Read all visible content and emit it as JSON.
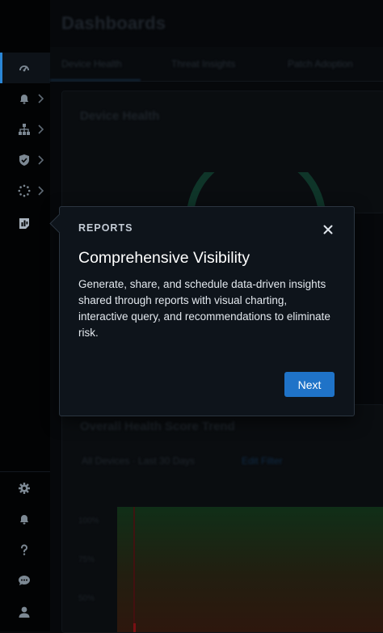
{
  "page": {
    "title": "Dashboards"
  },
  "tabs": [
    {
      "label": "Device Health"
    },
    {
      "label": "Threat Insights"
    },
    {
      "label": "Patch Adoption"
    }
  ],
  "cards": {
    "device_health": {
      "title": "Device Health"
    },
    "overall_health": {
      "title": "Overall Health Score Trend",
      "filter_label": "All Devices · Last 30 Days",
      "filter_link": "Edit Filter",
      "y_ticks": [
        "100%",
        "75%",
        "50%"
      ]
    }
  },
  "sidebar": {
    "items": [
      {
        "name": "dashboards",
        "icon": "speedometer-icon",
        "active": true
      },
      {
        "name": "alerts",
        "icon": "bell-icon",
        "has_submenu": true
      },
      {
        "name": "network",
        "icon": "hierarchy-icon",
        "has_submenu": true
      },
      {
        "name": "security",
        "icon": "shield-icon",
        "has_submenu": true
      },
      {
        "name": "integrations",
        "icon": "dotted-circle-icon",
        "has_submenu": true
      },
      {
        "name": "reports",
        "icon": "report-chart-icon"
      }
    ],
    "bottom_items": [
      {
        "name": "settings",
        "icon": "gear-icon"
      },
      {
        "name": "notifications",
        "icon": "bell-icon"
      },
      {
        "name": "help",
        "icon": "question-icon"
      },
      {
        "name": "chat",
        "icon": "chat-bubble-icon"
      },
      {
        "name": "profile",
        "icon": "user-icon"
      }
    ]
  },
  "tour": {
    "kicker": "REPORTS",
    "title": "Comprehensive Visibility",
    "body": "Generate, share, and schedule data-driven insights shared through reports with visual charting, interactive query, and recommendations to eliminate risk.",
    "next_label": "Next",
    "close_icon": "close-icon"
  },
  "colors": {
    "accent": "#1f73c8",
    "active_indicator": "#2a86d6",
    "popover_bg": "#0e141b",
    "gauge": "#1d8a64"
  }
}
